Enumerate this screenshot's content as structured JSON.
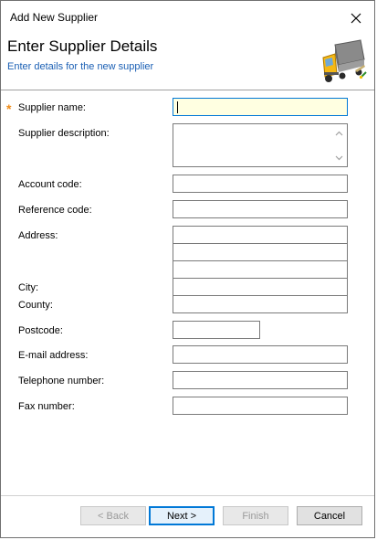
{
  "window": {
    "title": "Add New Supplier"
  },
  "header": {
    "heading": "Enter Supplier Details",
    "subheading": "Enter details for the new supplier",
    "icon": "truck-icon"
  },
  "form": {
    "required_marker": "*",
    "labels": {
      "supplier_name": "Supplier name:",
      "supplier_description": "Supplier description:",
      "account_code": "Account code:",
      "reference_code": "Reference code:",
      "address": "Address:",
      "city": "City:",
      "county": "County:",
      "postcode": "Postcode:",
      "email": "E-mail address:",
      "telephone": "Telephone number:",
      "fax": "Fax number:"
    },
    "values": {
      "supplier_name": "",
      "supplier_description": "",
      "account_code": "",
      "reference_code": "",
      "address_line1": "",
      "address_line2": "",
      "address_line3": "",
      "city": "",
      "county": "",
      "postcode": "",
      "email": "",
      "telephone": "",
      "fax": ""
    }
  },
  "buttons": {
    "back": "< Back",
    "next": "Next >",
    "finish": "Finish",
    "cancel": "Cancel"
  },
  "colors": {
    "accent": "#0078d7",
    "subheading": "#1a5fb4",
    "required": "#f08c18",
    "active_field_bg": "#ffffe1"
  }
}
